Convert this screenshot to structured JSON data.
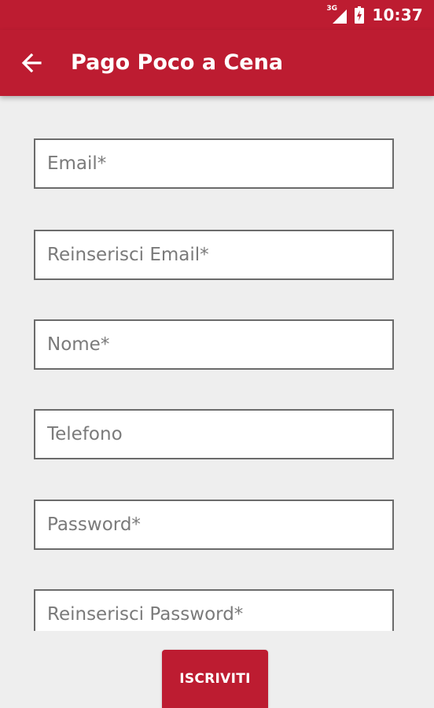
{
  "status_bar": {
    "network_type": "3G",
    "time": "10:37",
    "signal_icon": "cell-signal-icon",
    "battery_icon": "battery-charging-icon"
  },
  "app_bar": {
    "title": "Pago Poco a Cena",
    "back_icon": "arrow-back-icon",
    "color": "#bd1c31"
  },
  "form": {
    "fields": [
      {
        "placeholder": "Email*",
        "value": ""
      },
      {
        "placeholder": "Reinserisci Email*",
        "value": ""
      },
      {
        "placeholder": "Nome*",
        "value": ""
      },
      {
        "placeholder": "Telefono",
        "value": ""
      },
      {
        "placeholder": "Password*",
        "value": ""
      },
      {
        "placeholder": "Reinserisci Password*",
        "value": ""
      }
    ],
    "submit_label": "ISCRIVITI"
  }
}
